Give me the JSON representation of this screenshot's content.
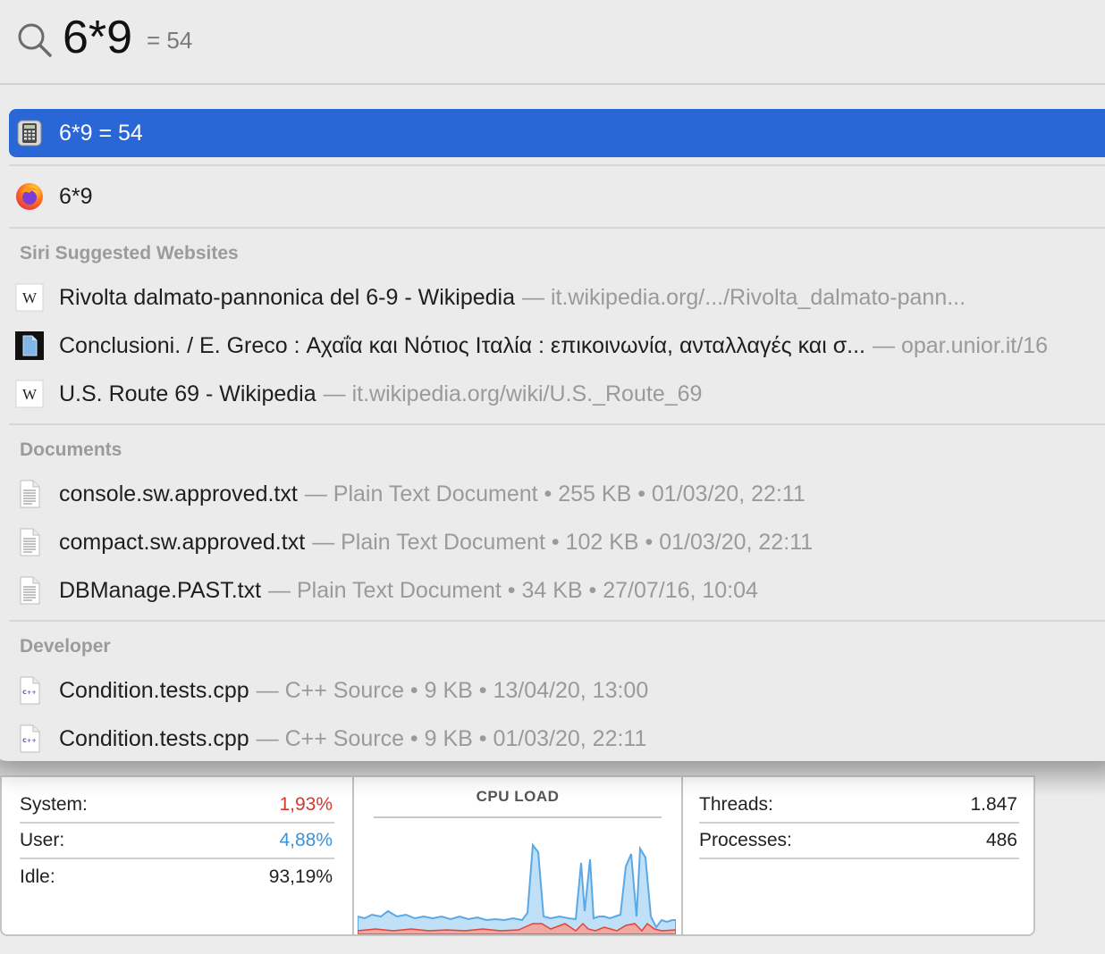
{
  "search": {
    "query": "6*9",
    "inline_result": "= 54"
  },
  "top_hit": {
    "label": "6*9 = 54",
    "icon": "calculator-icon"
  },
  "firefox_row": {
    "label": "6*9",
    "icon": "firefox-icon"
  },
  "sections": {
    "siri": "Siri Suggested Websites",
    "documents": "Documents",
    "developer": "Developer"
  },
  "websites": [
    {
      "title": "Rivolta dalmato-pannonica del 6-9 - Wikipedia",
      "detail": "— it.wikipedia.org/.../Rivolta_dalmato-pann...",
      "icon": "wikipedia-icon"
    },
    {
      "title": "Conclusioni. / E. Greco : Αχαΐα και Νότιος Ιταλία : επικοινωνία, ανταλλαγές και σ...",
      "detail": "— opar.unior.it/16",
      "icon": "document-icon"
    },
    {
      "title": "U.S. Route 69 - Wikipedia",
      "detail": "— it.wikipedia.org/wiki/U.S._Route_69",
      "icon": "wikipedia-icon"
    }
  ],
  "documents": [
    {
      "name": "console.sw.approved.txt",
      "detail": "— Plain Text Document • 255 KB • 01/03/20, 22:11",
      "icon": "text-file-icon"
    },
    {
      "name": "compact.sw.approved.txt",
      "detail": "— Plain Text Document • 102 KB • 01/03/20, 22:11",
      "icon": "text-file-icon"
    },
    {
      "name": "DBManage.PAST.txt",
      "detail": "— Plain Text Document • 34 KB • 27/07/16, 10:04",
      "icon": "text-file-icon"
    }
  ],
  "developer": [
    {
      "name": "Condition.tests.cpp",
      "detail": "— C++ Source • 9 KB • 13/04/20, 13:00",
      "icon": "cpp-file-icon"
    },
    {
      "name": "Condition.tests.cpp",
      "detail": "— C++ Source • 9 KB • 01/03/20, 22:11",
      "icon": "cpp-file-icon"
    }
  ],
  "activity": {
    "stats": [
      {
        "label": "System:",
        "value": "1,93%",
        "color": "#d23a2f"
      },
      {
        "label": "User:",
        "value": "4,88%",
        "color": "#3b93d8"
      },
      {
        "label": "Idle:",
        "value": "93,19%",
        "color": "#222222"
      }
    ],
    "graph_title": "CPU LOAD",
    "counts": [
      {
        "label": "Threads:",
        "value": "1.847"
      },
      {
        "label": "Processes:",
        "value": "486"
      }
    ],
    "colors": {
      "user": "#5aa9e6",
      "system": "#e0443a"
    }
  }
}
